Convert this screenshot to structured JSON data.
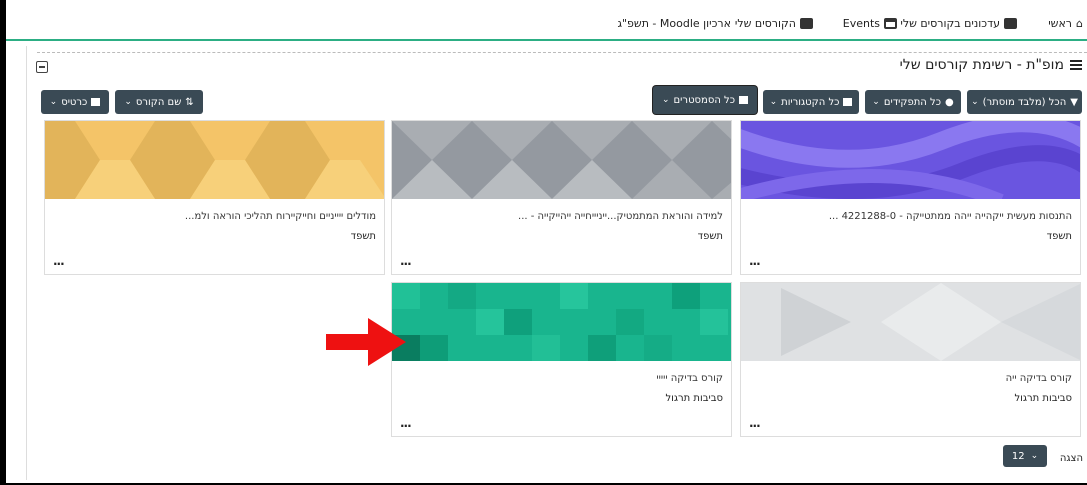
{
  "nav": {
    "home": "ראשי",
    "course_updates": "עדכונים בקורסים שלי",
    "events": "Events",
    "my_courses": "הקורסים שלי",
    "archive": "ארכיון Moodle - תשפ\"ג"
  },
  "block": {
    "title": "מופ\"ת - רשימת קורסים שלי"
  },
  "filters": {
    "all": "הכל (מלבד מוסתר)",
    "roles": "כל התפקידים",
    "categories": "כל הקטגוריות",
    "semesters": "כל הסמסטרים",
    "sort": "שם הקורס",
    "view": "כרטיס"
  },
  "courses": [
    {
      "name": "התנסות מעשית ייקהייה ייהה ממתטייקה - 4221288-0 ...",
      "sub": "תשפד",
      "more": "..."
    },
    {
      "name": "למידה והוראת המתמטיק...ייניייחייה ייהייקייה - ...",
      "sub": "תשפד",
      "more": "..."
    },
    {
      "name": "מודלים ייייניים וחייקיירוח תהליכי הוראה ולמ...",
      "sub": "תשפד",
      "more": "..."
    },
    {
      "name": "קורס בדיקה ייה",
      "sub": "סביבות תרגול",
      "more": "..."
    },
    {
      "name": "קורס בדיקה ייייי",
      "sub": "סביבות תרגול",
      "more": "..."
    }
  ],
  "pager": {
    "label": "הצגה",
    "value": "12"
  },
  "colors": {
    "accent_green": "#2cae84",
    "button_dark": "#3a4a55",
    "arrow_red": "#ee1111"
  }
}
